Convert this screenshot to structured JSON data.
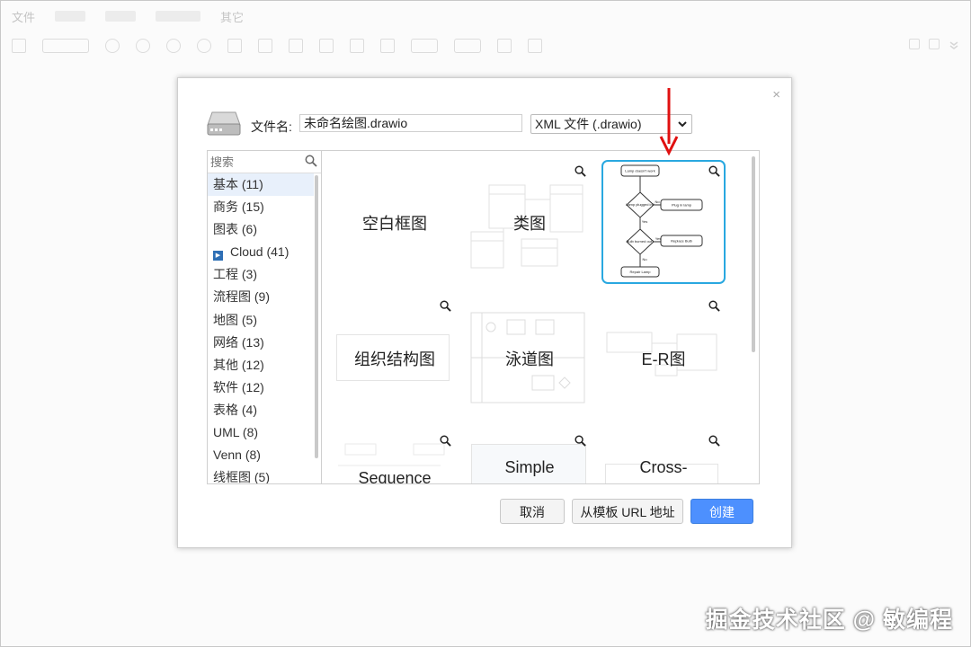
{
  "menubar": {
    "file": "文件",
    "other": "其它"
  },
  "dialog": {
    "filename_label": "文件名:",
    "filename_value": "未命名绘图.drawio",
    "format_selected": "XML 文件 (.drawio)",
    "close": "×"
  },
  "search": {
    "placeholder": "搜索"
  },
  "categories": [
    {
      "label": "基本 (11)"
    },
    {
      "label": "商务 (15)"
    },
    {
      "label": "图表 (6)"
    },
    {
      "label": "Cloud (41)"
    },
    {
      "label": "工程 (3)"
    },
    {
      "label": "流程图 (9)"
    },
    {
      "label": "地图 (5)"
    },
    {
      "label": "网络 (13)"
    },
    {
      "label": "其他 (12)"
    },
    {
      "label": "软件 (12)"
    },
    {
      "label": "表格 (4)"
    },
    {
      "label": "UML (8)"
    },
    {
      "label": "Venn (8)"
    },
    {
      "label": "线框图 (5)"
    }
  ],
  "templates": {
    "blank": "空白框图",
    "class": "类图",
    "org": "组织结构图",
    "swimlane": "泳道图",
    "er": "E-R图",
    "sequence": "Sequence",
    "simple": "Simple",
    "cross": "Cross-"
  },
  "flowchart": {
    "start": "Lamp doesn't work",
    "q1": "Lamp plugged in?",
    "no1": "No",
    "yes1": "Yes",
    "act1": "Plug in lamp",
    "q2": "Bulb burned out?",
    "yes2": "Yes",
    "no2": "No",
    "act2": "Replace Bulb",
    "end": "Repair Lamp"
  },
  "buttons": {
    "cancel": "取消",
    "from_url": "从模板 URL 地址",
    "create": "创建"
  },
  "colors": {
    "accent": "#4d90fe",
    "selection": "#29a8e0",
    "arrow": "#e01010"
  },
  "watermark": "掘金技术社区 @ 敏编程"
}
